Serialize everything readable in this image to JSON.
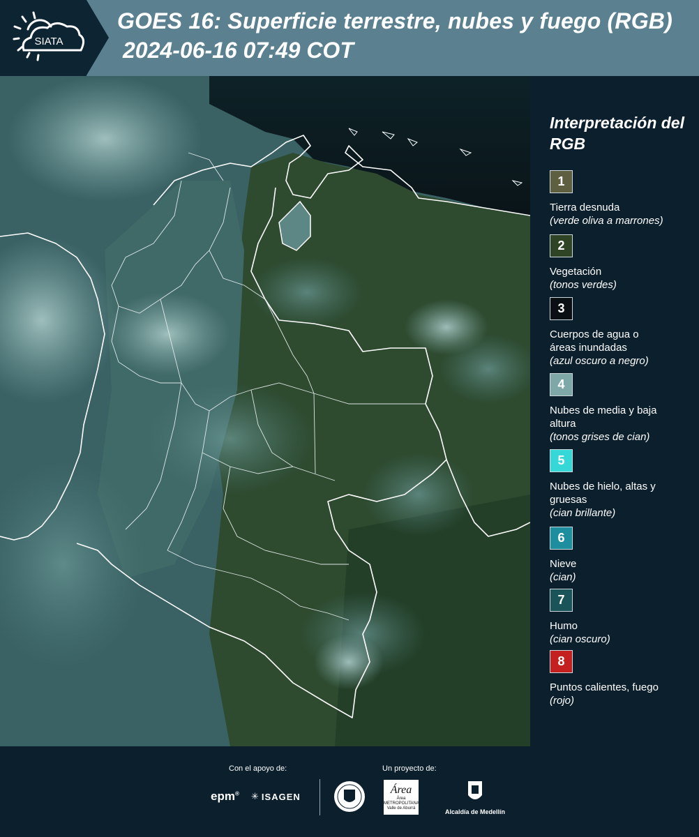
{
  "header": {
    "logo_text": "SIATA",
    "title_line1": "GOES 16: Superficie terrestre, nubes y fuego (RGB)",
    "title_line2": "2024-06-16 07:49 COT",
    "background_color": "#5b8190"
  },
  "map": {
    "description_icon": "satellite-rgb-map"
  },
  "legend": {
    "title": "Interpretación del RGB",
    "items": [
      {
        "number": "1",
        "name": "Tierra desnuda",
        "desc": "(verde oliva a marrones)",
        "color": "#5e5f40"
      },
      {
        "number": "2",
        "name": "Vegetación",
        "desc": "(tonos verdes)",
        "color": "#2e4424"
      },
      {
        "number": "3",
        "name": "Cuerpos de agua o áreas inundadas",
        "desc": "(azul oscuro a negro)",
        "color": "#0a0f14"
      },
      {
        "number": "4",
        "name": "Nubes de media y baja altura",
        "desc": "(tonos grises de cian)",
        "color": "#7ea7a8"
      },
      {
        "number": "5",
        "name": "Nubes de hielo, altas y gruesas",
        "desc": "(cian brillante)",
        "color": "#35d8d6"
      },
      {
        "number": "6",
        "name": "Nieve",
        "desc": "(cian)",
        "color": "#1d8e9d"
      },
      {
        "number": "7",
        "name": "Humo",
        "desc": "(cian oscuro)",
        "color": "#1b5458"
      },
      {
        "number": "8",
        "name": "Puntos calientes, fuego",
        "desc": "(rojo)",
        "color": "#c4201f"
      }
    ]
  },
  "footer": {
    "support_label": "Con el apoyo de:",
    "project_label": "Un proyecto de:",
    "epm": "epm",
    "isagen": "ISAGEN",
    "area_text": "Área METROPOLITANA Valle de Aburrá",
    "alcaldia": "Alcaldía de Medellín"
  }
}
